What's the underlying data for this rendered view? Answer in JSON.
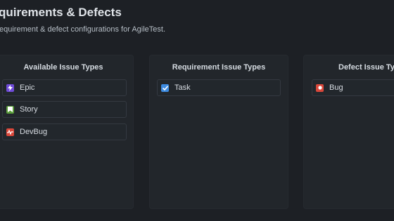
{
  "header": {
    "title": "quirements & Defects",
    "subtitle": "equirement & defect configurations for AgileTest."
  },
  "panels": {
    "available": {
      "title": "Available Issue Types",
      "items": [
        {
          "label": "Epic",
          "icon": "epic-icon",
          "color": "#6f4bd8"
        },
        {
          "label": "Story",
          "icon": "story-icon",
          "color": "#5a9e3a"
        },
        {
          "label": "DevBug",
          "icon": "devbug-icon",
          "color": "#d9473a"
        }
      ]
    },
    "requirement": {
      "title": "Requirement Issue Types",
      "items": [
        {
          "label": "Task",
          "icon": "task-icon",
          "color": "#3d8be0"
        }
      ]
    },
    "defect": {
      "title": "Defect Issue Ty",
      "items": [
        {
          "label": "Bug",
          "icon": "bug-icon",
          "color": "#d9473a"
        }
      ]
    }
  }
}
